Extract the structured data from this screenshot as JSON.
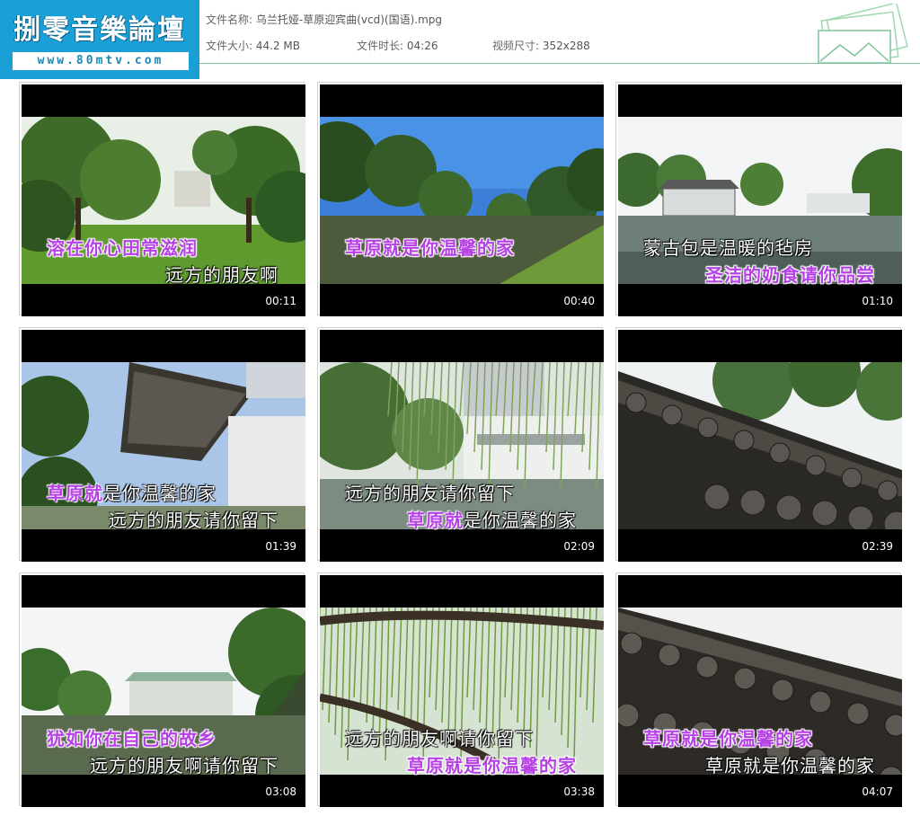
{
  "logo": {
    "title": "捌零音樂論壇",
    "url": "www.80mtv.com"
  },
  "file": {
    "name_label": "文件名称:",
    "name_value": "乌兰托娅-草原迎宾曲(vcd)(国语).mpg",
    "size_label": "文件大小:",
    "size_value": "44.2 MB",
    "duration_label": "文件时长:",
    "duration_value": "04:26",
    "dims_label": "视频尺寸:",
    "dims_value": "352x288"
  },
  "thumbnails": [
    {
      "time": "00:11",
      "scene": "park-trees",
      "line1": {
        "text": "溶在你心田常滋润",
        "color": "purple"
      },
      "line2": {
        "text": "远方的朋友啊",
        "color": "white"
      }
    },
    {
      "time": "00:40",
      "scene": "sky-trees",
      "line1": {
        "text": "草原就是你温馨的家",
        "color": "purple"
      },
      "line2": {
        "text": "",
        "color": "white"
      }
    },
    {
      "time": "01:10",
      "scene": "moat-building",
      "line1": {
        "text": "蒙古包是温暖的毡房",
        "color": "white"
      },
      "line2": {
        "text": "圣洁的奶食请你品尝",
        "color": "purple"
      }
    },
    {
      "time": "01:39",
      "scene": "roof-gate",
      "line1": {
        "text": "草原就是你温馨的家",
        "color": "mixed",
        "hl": "草原就",
        "rest": "是你温馨的家"
      },
      "line2": {
        "text": "远方的朋友请你留下",
        "color": "white"
      }
    },
    {
      "time": "02:09",
      "scene": "willow-building",
      "line1": {
        "text": "远方的朋友请你留下",
        "color": "white"
      },
      "line2": {
        "text": "草原就是你温馨的家",
        "color": "mixed",
        "hl": "草原就",
        "rest": "是你温馨的家"
      }
    },
    {
      "time": "02:39",
      "scene": "roof-tiles",
      "line1": {
        "text": "",
        "color": "white"
      },
      "line2": {
        "text": "",
        "color": "white"
      }
    },
    {
      "time": "03:08",
      "scene": "hill-building",
      "line1": {
        "text": "犹如你在自己的故乡",
        "color": "purple"
      },
      "line2": {
        "text": "远方的朋友啊请你留下",
        "color": "white"
      }
    },
    {
      "time": "03:38",
      "scene": "willow-branch",
      "line1": {
        "text": "远方的朋友啊请你留下",
        "color": "white"
      },
      "line2": {
        "text": "草原就是你温馨的家",
        "color": "purple"
      }
    },
    {
      "time": "04:07",
      "scene": "roof-tiles-2",
      "line1": {
        "text": "草原就是你温馨的家",
        "color": "purple"
      },
      "line2": {
        "text": "草原就是你温馨的家",
        "color": "white"
      }
    }
  ]
}
